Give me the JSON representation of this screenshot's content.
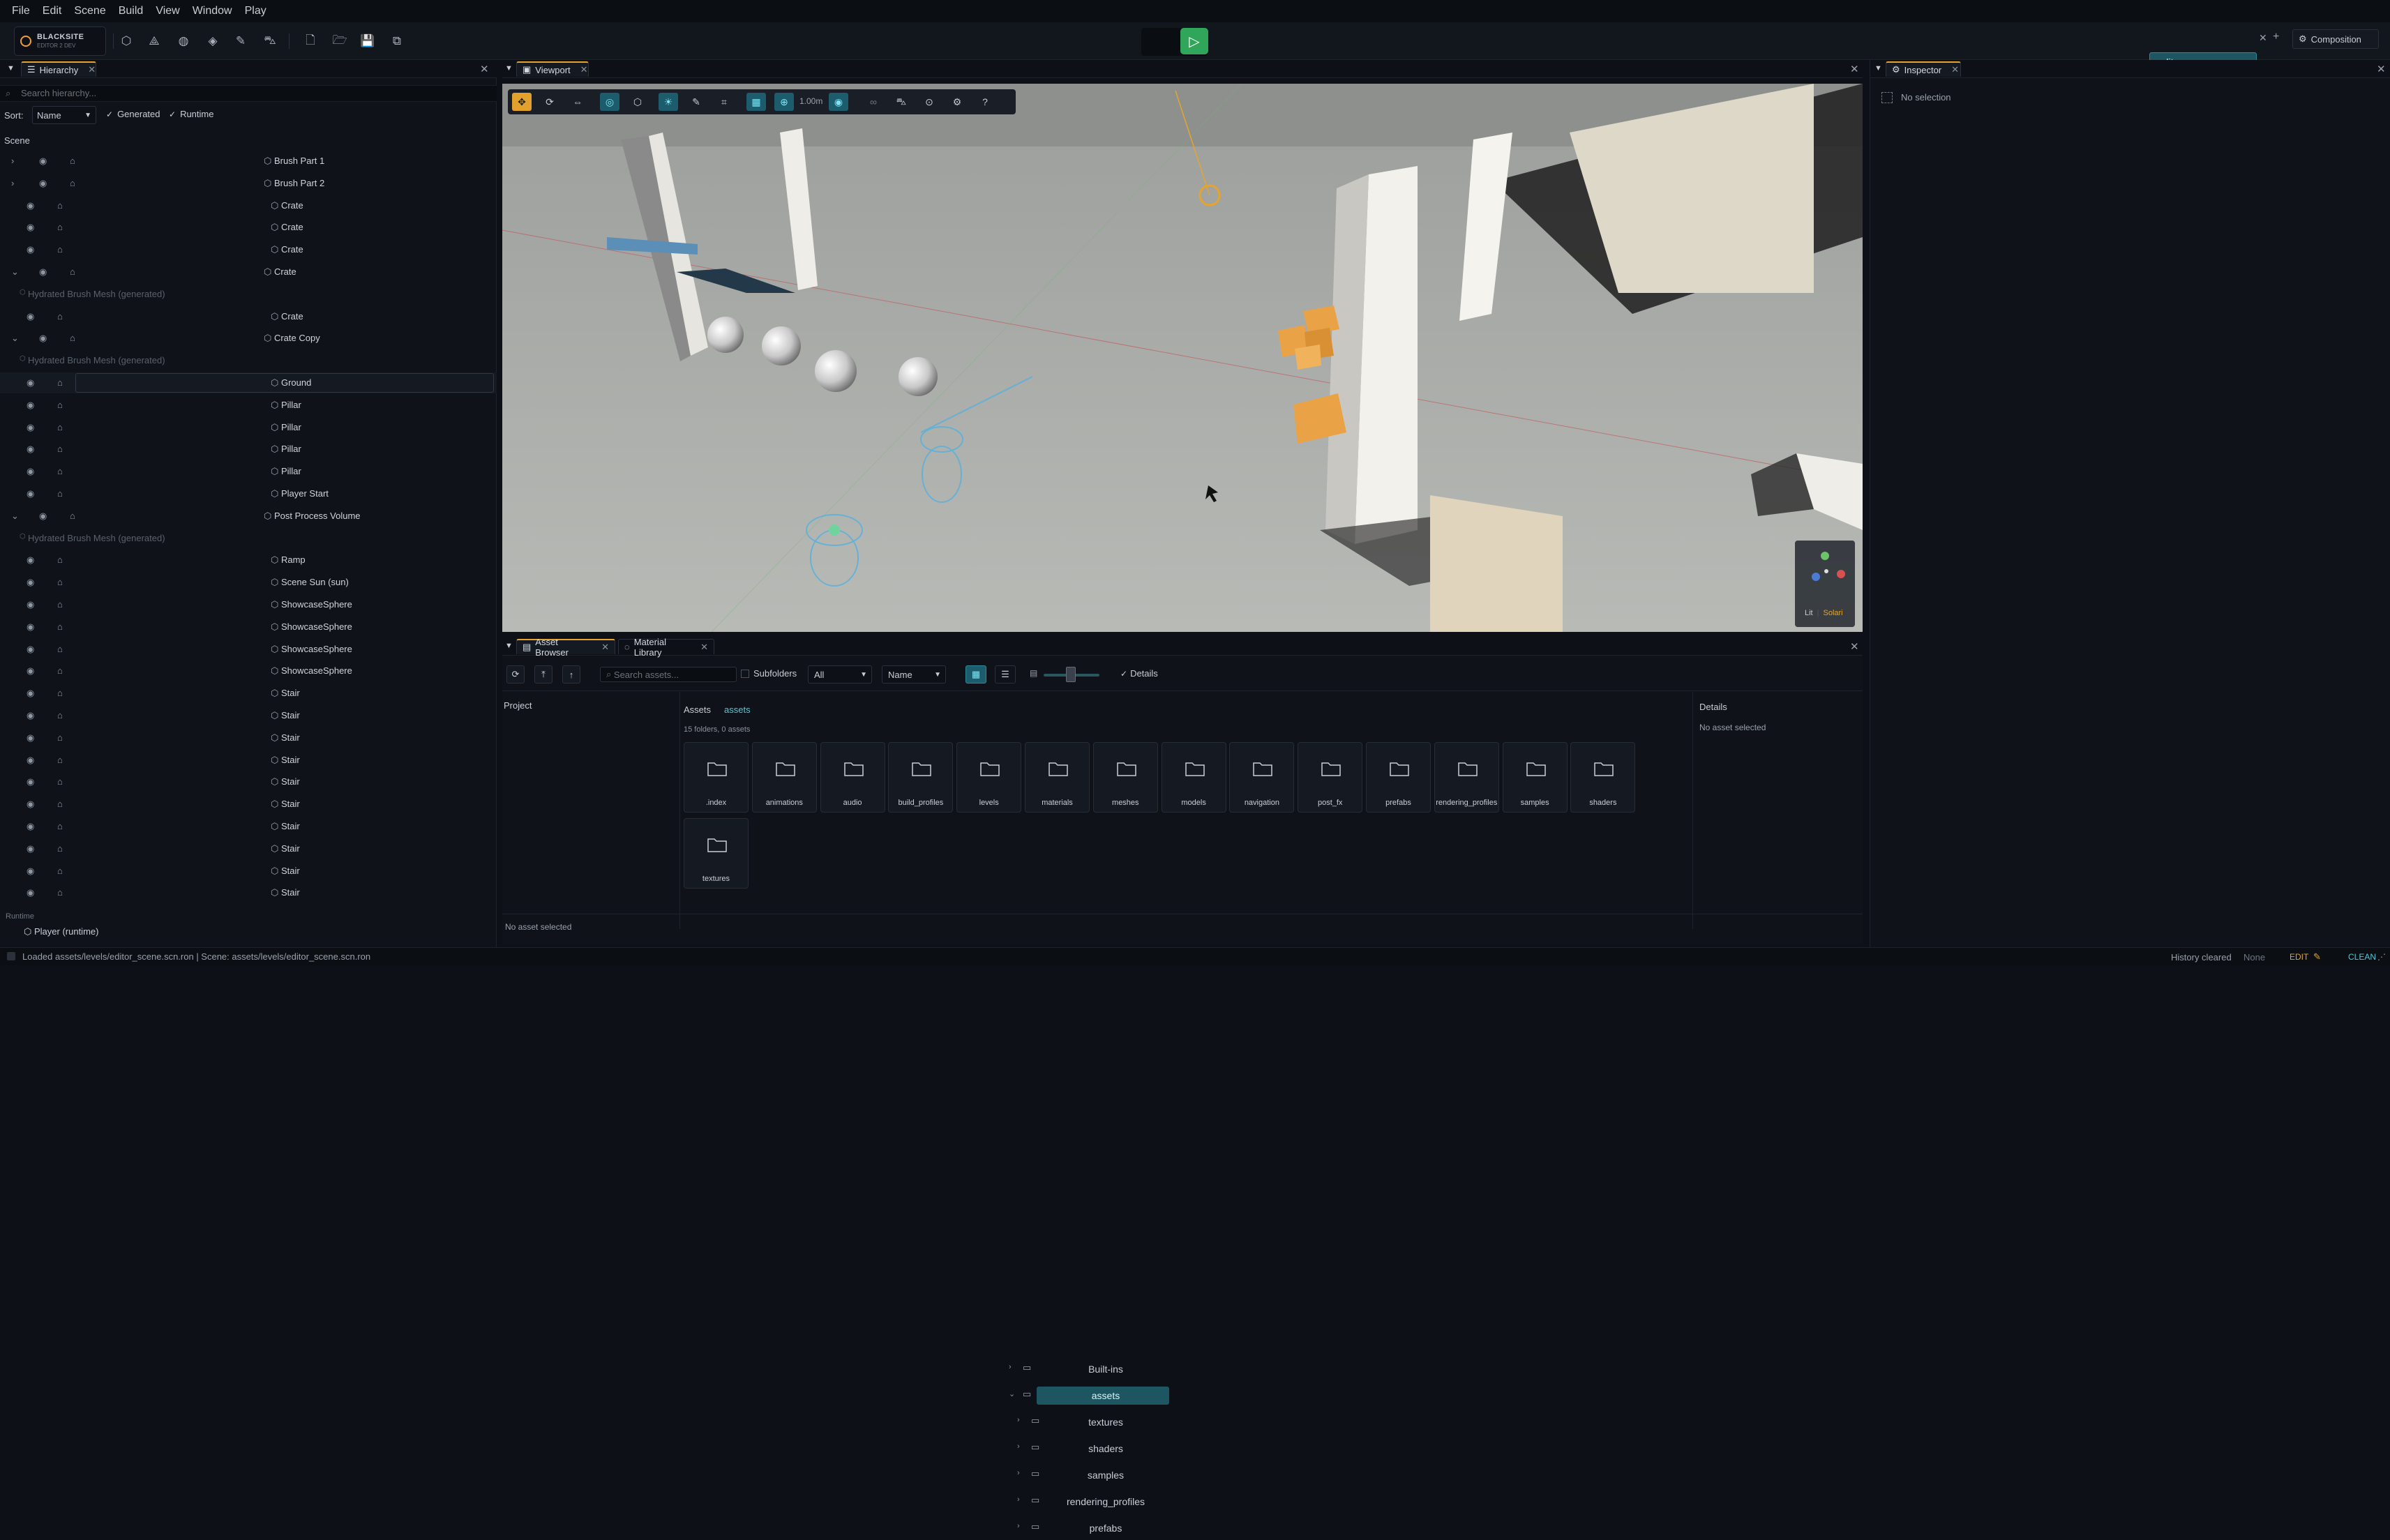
{
  "menu": [
    "File",
    "Edit",
    "Scene",
    "Build",
    "View",
    "Window",
    "Play"
  ],
  "logo": {
    "name": "BLACKSITE",
    "sub": "EDITOR 2 DEV"
  },
  "toolbar": {
    "scene_file": "editor_scene.scn.ron",
    "composition": "Composition",
    "play_icon": "play-icon"
  },
  "hierarchy": {
    "tab": "Hierarchy",
    "search_placeholder": "Search hierarchy...",
    "sort_label": "Sort:",
    "sort_value": "Name",
    "generated_label": "Generated",
    "runtime_label": "Runtime",
    "scene_label": "Scene",
    "rows": [
      {
        "label": "Brush Part 1",
        "kind": "exp"
      },
      {
        "label": "Brush Part 2",
        "kind": "exp"
      },
      {
        "label": "Crate",
        "kind": "leaf"
      },
      {
        "label": "Crate",
        "kind": "leaf"
      },
      {
        "label": "Crate",
        "kind": "leaf"
      },
      {
        "label": "Crate",
        "kind": "open"
      },
      {
        "label": "Hydrated Brush Mesh  (generated)",
        "kind": "gen"
      },
      {
        "label": "Crate",
        "kind": "leaf"
      },
      {
        "label": "Crate Copy",
        "kind": "open"
      },
      {
        "label": "Hydrated Brush Mesh  (generated)",
        "kind": "gen"
      },
      {
        "label": "Ground",
        "kind": "sel"
      },
      {
        "label": "Pillar",
        "kind": "leaf"
      },
      {
        "label": "Pillar",
        "kind": "leaf"
      },
      {
        "label": "Pillar",
        "kind": "leaf"
      },
      {
        "label": "Pillar",
        "kind": "leaf"
      },
      {
        "label": "Player Start",
        "kind": "leaf"
      },
      {
        "label": "Post Process Volume",
        "kind": "open"
      },
      {
        "label": "Hydrated Brush Mesh  (generated)",
        "kind": "gen"
      },
      {
        "label": "Ramp",
        "kind": "leaf"
      },
      {
        "label": "Scene Sun  (sun)",
        "kind": "leaf"
      },
      {
        "label": "ShowcaseSphere",
        "kind": "leaf"
      },
      {
        "label": "ShowcaseSphere",
        "kind": "leaf"
      },
      {
        "label": "ShowcaseSphere",
        "kind": "leaf"
      },
      {
        "label": "ShowcaseSphere",
        "kind": "leaf"
      },
      {
        "label": "Stair",
        "kind": "leaf"
      },
      {
        "label": "Stair",
        "kind": "leaf"
      },
      {
        "label": "Stair",
        "kind": "leaf"
      },
      {
        "label": "Stair",
        "kind": "leaf"
      },
      {
        "label": "Stair",
        "kind": "leaf"
      },
      {
        "label": "Stair",
        "kind": "leaf"
      },
      {
        "label": "Stair",
        "kind": "leaf"
      },
      {
        "label": "Stair",
        "kind": "leaf"
      },
      {
        "label": "Stair",
        "kind": "leaf"
      },
      {
        "label": "Stair",
        "kind": "leaf"
      }
    ],
    "runtime_section": "Runtime",
    "runtime_item": "Player  (runtime)"
  },
  "viewport": {
    "tab": "Viewport",
    "snap_value": "1.00m",
    "gizmo_lit": "Lit",
    "gizmo_solari": "Solari"
  },
  "asset_browser": {
    "tab": "Asset Browser",
    "tab2": "Material Library",
    "search_placeholder": "Search assets...",
    "subfolders_label": "Subfolders",
    "filter_value": "All",
    "sort_value": "Name",
    "details_toggle": "Details",
    "project_label": "Project",
    "tree": [
      "Built-ins",
      "assets",
      "textures",
      "shaders",
      "samples",
      "rendering_profiles",
      "prefabs"
    ],
    "breadcrumb_root": "Assets",
    "breadcrumb_current": "assets",
    "summary": "15 folders, 0 assets",
    "folders": [
      ".index",
      "animations",
      "audio",
      "build_profiles",
      "levels",
      "materials",
      "meshes",
      "models",
      "navigation",
      "post_fx",
      "prefabs",
      "rendering_profiles",
      "samples",
      "shaders",
      "textures"
    ],
    "details_title": "Details",
    "details_empty": "No asset selected",
    "footer": "No asset selected"
  },
  "inspector": {
    "tab": "Inspector",
    "empty": "No selection"
  },
  "status": {
    "left": "Loaded assets/levels/editor_scene.scn.ron  |  Scene: assets/levels/editor_scene.scn.ron",
    "history": "History cleared",
    "none": "None",
    "edit": "EDIT",
    "clean": "CLEAN"
  },
  "colors": {
    "accent": "#e6a42c",
    "teal": "#2f8a99",
    "play": "#2fa65a"
  }
}
